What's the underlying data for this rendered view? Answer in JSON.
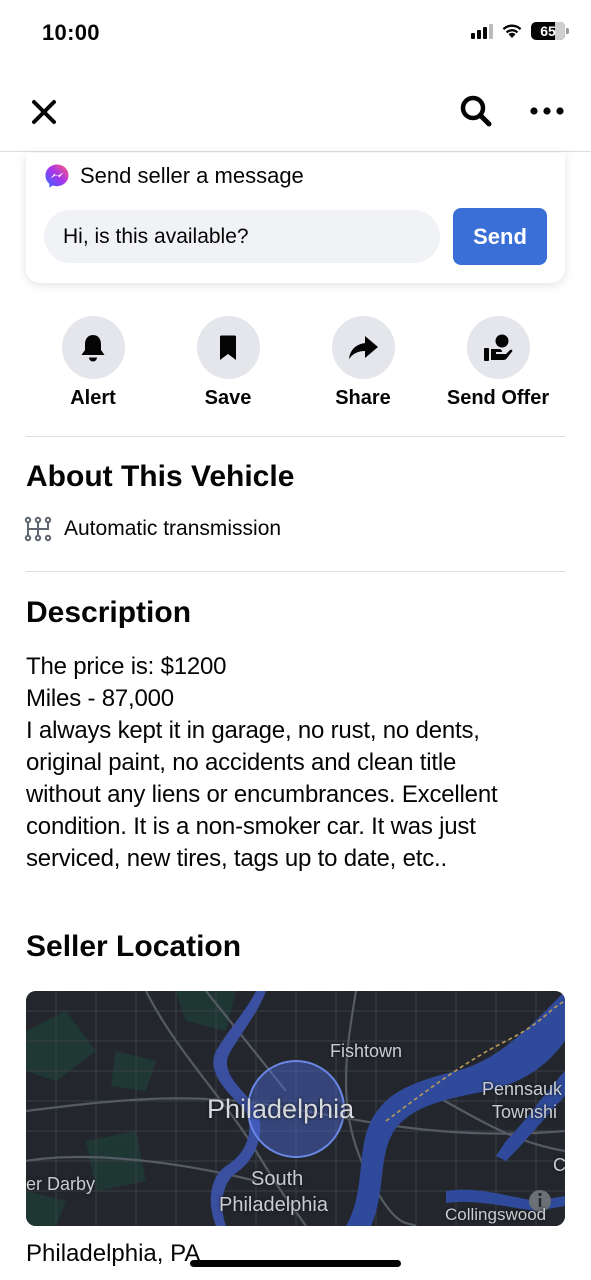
{
  "status_bar": {
    "time": "10:00",
    "battery": "65"
  },
  "nav": {
    "close_icon": "close-icon",
    "search_icon": "search-icon",
    "more_icon": "more-icon"
  },
  "message": {
    "header": "Send seller a message",
    "input_value": "Hi, is this available?",
    "send_label": "Send",
    "accent": "#3a6fd8"
  },
  "actions": [
    {
      "label": "Alert",
      "icon": "bell-icon"
    },
    {
      "label": "Save",
      "icon": "bookmark-icon"
    },
    {
      "label": "Share",
      "icon": "share-arrow-icon"
    },
    {
      "label": "Send Offer",
      "icon": "hand-offer-icon"
    }
  ],
  "about": {
    "title": "About This Vehicle",
    "transmission": "Automatic transmission"
  },
  "description": {
    "title": "Description",
    "lines": [
      "The price is: $1200",
      "Miles - 87,000",
      "I always kept it in garage, no rust, no dents,",
      "original paint, no accidents and clean title",
      "without any liens or encumbrances. Excellent",
      "condition. It is a non-smoker car. It was just",
      "serviced, new tires, tags up to date, etc.."
    ]
  },
  "location": {
    "title": "Seller Location",
    "map_labels": {
      "fishtown": "Fishtown",
      "philadelphia": "Philadelphia",
      "pennsauken": "Pennsauk",
      "township": "Townshi",
      "darby": "er Darby",
      "south": "South",
      "south_philly": "Philadelphia",
      "collingswood": "Collingswood",
      "c": "C"
    },
    "city": "Philadelphia, PA"
  }
}
